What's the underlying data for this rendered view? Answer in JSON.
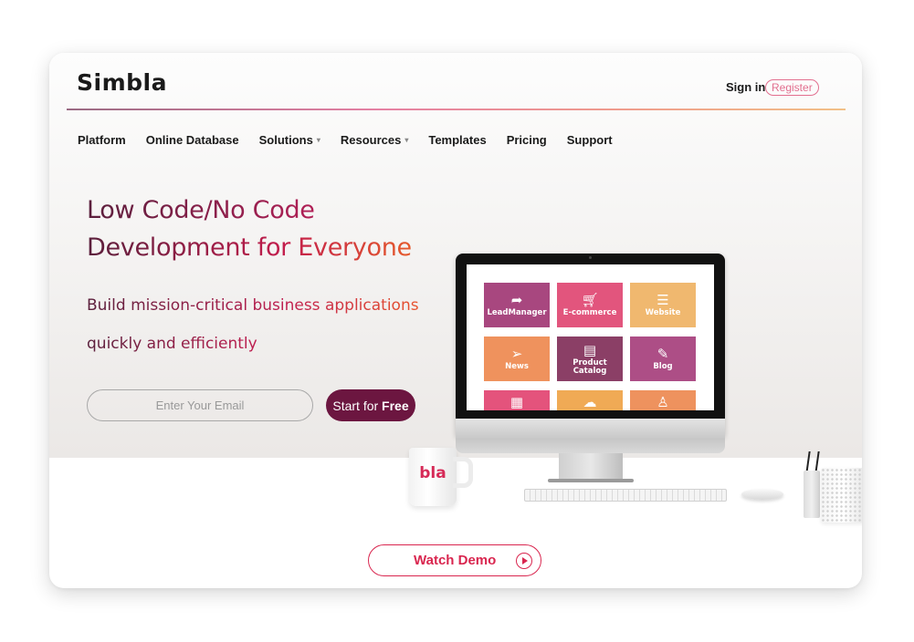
{
  "header": {
    "logo": "Simbla",
    "sign_in": "Sign in",
    "register": "Register"
  },
  "nav": {
    "items": [
      {
        "label": "Platform",
        "dropdown": false
      },
      {
        "label": "Online Database",
        "dropdown": false
      },
      {
        "label": "Solutions",
        "dropdown": true
      },
      {
        "label": "Resources",
        "dropdown": true
      },
      {
        "label": "Templates",
        "dropdown": false
      },
      {
        "label": "Pricing",
        "dropdown": false
      },
      {
        "label": "Support",
        "dropdown": false
      }
    ],
    "caret_glyph": "▾"
  },
  "hero": {
    "headline_line1": "Low Code/No Code",
    "headline_line2": "Development for Everyone",
    "subline_line1": "Build mission-critical business applications",
    "subline_line2": "quickly and efficiently",
    "email_placeholder": "Enter Your Email",
    "email_value": "",
    "start_label_prefix": "Start for ",
    "start_label_bold": "Free"
  },
  "screen_tiles": [
    {
      "label": "LeadManager",
      "icon": "share-arrow-icon",
      "glyph": "➦",
      "color": "#a8477f"
    },
    {
      "label": "E-commerce",
      "icon": "cart-icon",
      "glyph": "🛒︎",
      "color": "#e2557d"
    },
    {
      "label": "Website",
      "icon": "website-icon",
      "glyph": "☰",
      "color": "#f0b86f"
    },
    {
      "label": "News",
      "icon": "paper-plane-icon",
      "glyph": "➢",
      "color": "#ef925d"
    },
    {
      "label": "Product Catalog",
      "icon": "catalog-icon",
      "glyph": "▤",
      "color": "#8b3f66"
    },
    {
      "label": "Blog",
      "icon": "pencil-icon",
      "glyph": "✎",
      "color": "#ad4e86"
    },
    {
      "label": "",
      "icon": "calendar-icon",
      "glyph": "▦",
      "color": "#e4537c"
    },
    {
      "label": "",
      "icon": "cloud-icon",
      "glyph": "☁",
      "color": "#f0aa55"
    },
    {
      "label": "",
      "icon": "user-icon",
      "glyph": "♙",
      "color": "#ee925e"
    }
  ],
  "mug_logo": "bla",
  "watch_demo": {
    "label": "Watch Demo"
  },
  "colors": {
    "brand_dark": "#6c1640",
    "accent_red": "#d9264f",
    "register_pink": "#e26f8f"
  }
}
